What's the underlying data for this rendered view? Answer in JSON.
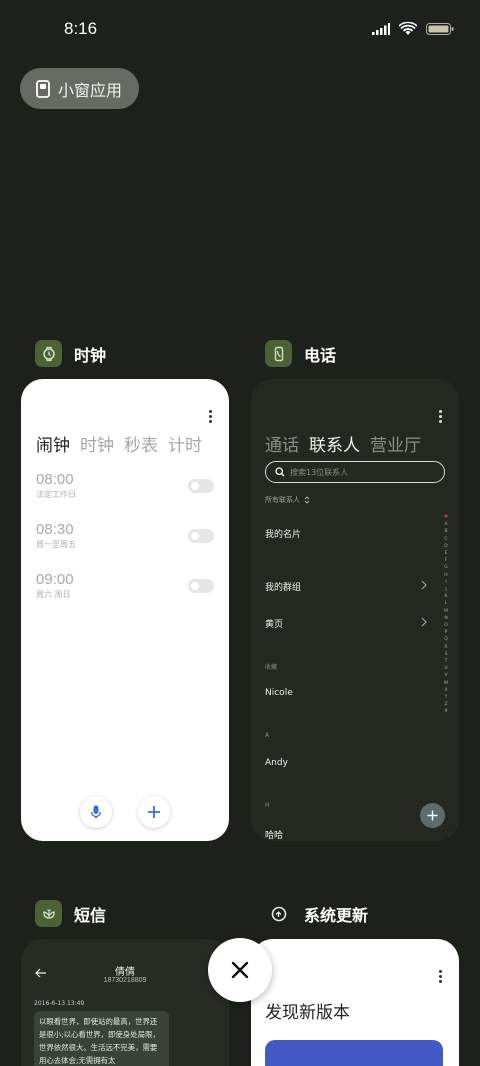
{
  "status_bar": {
    "time": "8:16",
    "icons": [
      "cellular-signal-icon",
      "wifi-icon",
      "battery-icon"
    ]
  },
  "mini_window": {
    "label": "小窗应用",
    "icon": "mini-window-icon"
  },
  "apps": {
    "clock": {
      "name": "时钟",
      "icon": "watch-icon",
      "tabs": [
        "闹钟",
        "时钟",
        "秒表",
        "计时"
      ],
      "active_tab": "闹钟",
      "alarms": [
        {
          "time": "08:00",
          "desc": "法定工作日",
          "enabled": false
        },
        {
          "time": "08:30",
          "desc": "周一至周五",
          "enabled": false
        },
        {
          "time": "09:00",
          "desc": "周六 周日",
          "enabled": false
        }
      ],
      "buttons": [
        "mic-icon",
        "plus-icon"
      ]
    },
    "phone": {
      "name": "电话",
      "icon": "phone-icon",
      "tabs": [
        "通话",
        "联系人",
        "营业厅"
      ],
      "active_tab": "联系人",
      "search_placeholder": "搜索13位联系人",
      "filter_label": "所有联系人",
      "my_card": "我的名片",
      "my_groups": "我的群组",
      "yellow_pages": "黄页",
      "favorites_header": "收藏",
      "favorite_contact": "Nicole",
      "section_a": "A",
      "contact_a": "Andy",
      "section_h": "H",
      "contact_h": "哈哈",
      "alphabet": [
        "♥",
        "A",
        "B",
        "C",
        "D",
        "E",
        "F",
        "G",
        "H",
        "I",
        "J",
        "K",
        "L",
        "M",
        "N",
        "O",
        "P",
        "Q",
        "R",
        "S",
        "T",
        "U",
        "V",
        "W",
        "X",
        "Y",
        "Z",
        "#"
      ],
      "accent": "#e0393e"
    },
    "sms": {
      "name": "短信",
      "icon": "butterfly-icon",
      "contact_name": "倩倩",
      "contact_number": "18730218809",
      "date": "2016-6-13 13:49",
      "message": "以眼看世界，即使站的最高，世界还是很小;以心看世界，即使身处局限，世界依然很大。生活远不完美，需要用心去体会;无需拥有太"
    },
    "update": {
      "name": "系统更新",
      "icon": "update-icon",
      "title": "发现新版本",
      "banner_color": "#4359c4"
    }
  },
  "close_button": "close-icon"
}
